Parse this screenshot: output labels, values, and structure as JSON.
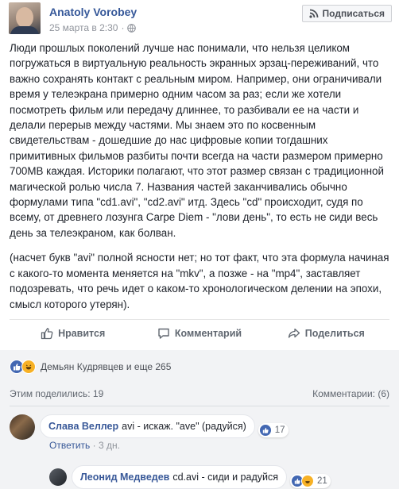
{
  "post": {
    "author": "Anatoly Vorobey",
    "timestamp": "25 марта в 2:30",
    "subscribe_label": "Подписаться",
    "paragraphs": [
      "Люди прошлых поколений лучше нас понимали, что нельзя целиком погружаться в виртуальную реальность экранных эрзац-переживаний, что важно сохранять контакт с реальным миром. Например, они ограничивали время у телеэкрана примерно одним часом за раз; если же хотели посмотреть фильм или передачу длиннее, то разбивали ее на части и делали перерыв между частями. Мы знаем это по косвенным свидетельствам - дошедшие до нас цифровые копии тогдашних примитивных фильмов разбиты почти всегда на части размером примерно 700MB каждая. Историки полагают, что этот размер связан с традиционной магической ролью числа 7. Названия частей заканчивались обычно формулами типа \"cd1.avi\", \"cd2.avi\" итд. Здесь \"cd\" происходит, судя по всему, от древнего лозунга Carpe Diem - \"лови день\", то есть не сиди весь день за телеэкраном, как болван.",
      "(насчет букв \"avi\" полной ясности нет; но тот факт, что эта формула начиная с какого-то момента меняется на \"mkv\", а позже - на \"mp4\", заставляет подозревать, что речь идет о каком-то хронологическом делении на эпохи, смысл которого утерян)."
    ]
  },
  "actions": {
    "like": "Нравится",
    "comment": "Комментарий",
    "share": "Поделиться"
  },
  "reactions": {
    "names": "Демьян Кудрявцев и еще 265"
  },
  "stats": {
    "shared": "Этим поделились: 19",
    "comments": "Комментарии: (6)"
  },
  "comments": [
    {
      "author": "Слава Веллер",
      "text": "avi - искаж. \"ave\" (радуйся)",
      "count": "17",
      "reply_label": "Ответить",
      "time": "3 дн."
    },
    {
      "author": "Леонид Медведев",
      "text": "cd.avi - сиди и радуйся",
      "count": "21"
    }
  ],
  "colors": {
    "link": "#365899",
    "like_blue": "#4267b2",
    "haha_yellow": "#f7b125"
  }
}
